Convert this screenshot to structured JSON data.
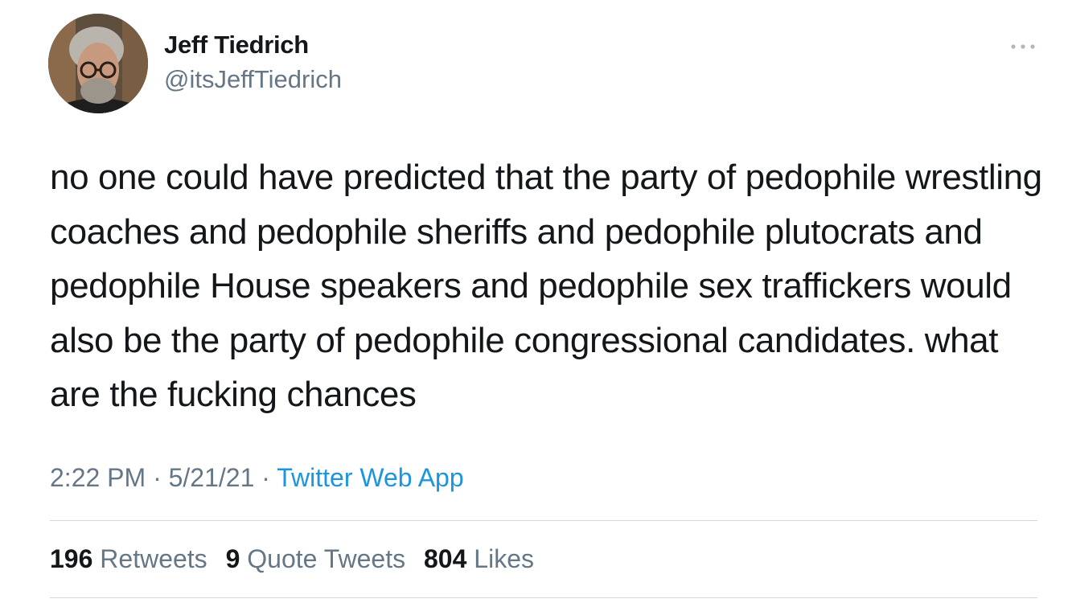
{
  "author": {
    "display_name": "Jeff Tiedrich",
    "handle": "@itsJeffTiedrich"
  },
  "tweet": {
    "text": "no one could have predicted that the party of pedophile wrestling coaches and pedophile sheriffs and pedophile plutocrats and pedophile House speakers and pedophile sex traffickers would also be the party of pedophile congressional candidates. what are the fucking chances"
  },
  "meta": {
    "time": "2:22 PM",
    "separator": "·",
    "date": "5/21/21",
    "source": "Twitter Web App"
  },
  "stats": [
    {
      "count": "196",
      "label": "Retweets"
    },
    {
      "count": "9",
      "label": "Quote Tweets"
    },
    {
      "count": "804",
      "label": "Likes"
    }
  ],
  "icons": {
    "more": "more-dots-icon",
    "avatar": "avatar"
  },
  "colors": {
    "text": "#14171a",
    "secondary": "#657786",
    "link": "#1b95e0",
    "divider": "#d4d8dc"
  }
}
